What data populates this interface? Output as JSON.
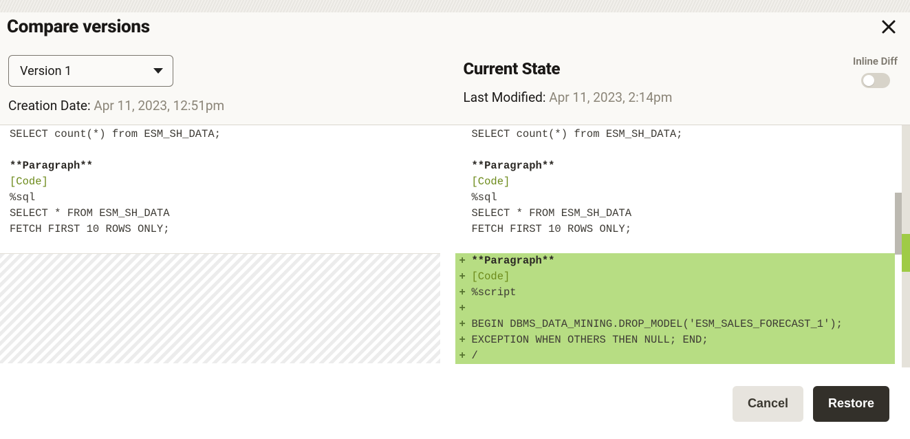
{
  "header": {
    "title": "Compare versions"
  },
  "left": {
    "version_select": "Version 1",
    "meta_label": "Creation Date: ",
    "meta_value": "Apr 11, 2023, 12:51pm",
    "lines": {
      "l1": "SELECT count(*) from ESM_SH_DATA;",
      "l2": "",
      "para": "**Paragraph**",
      "code_tag": "[Code]",
      "l3": "%sql",
      "l4": "SELECT * FROM ESM_SH_DATA",
      "l5": "FETCH FIRST 10 ROWS ONLY;"
    }
  },
  "right": {
    "title": "Current State",
    "meta_label": "Last Modified: ",
    "meta_value": "Apr 11, 2023, 2:14pm",
    "inline_diff_label": "Inline Diff",
    "lines": {
      "l1": "SELECT count(*) from ESM_SH_DATA;",
      "l2": "",
      "para": "**Paragraph**",
      "code_tag": "[Code]",
      "l3": "%sql",
      "l4": "SELECT * FROM ESM_SH_DATA",
      "l5": "FETCH FIRST 10 ROWS ONLY;"
    },
    "added": {
      "plus": "+",
      "para": "**Paragraph**",
      "code_tag": "[Code]",
      "a1": "%script",
      "a2": "",
      "a3": "BEGIN DBMS_DATA_MINING.DROP_MODEL('ESM_SALES_FORECAST_1');",
      "a4": "EXCEPTION WHEN OTHERS THEN NULL; END;",
      "a5": "/"
    }
  },
  "footer": {
    "cancel": "Cancel",
    "restore": "Restore"
  }
}
